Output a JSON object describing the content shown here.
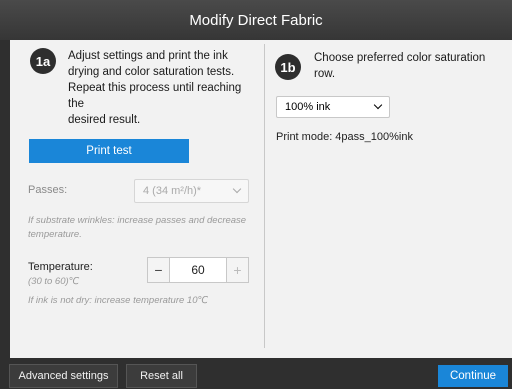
{
  "window": {
    "title": "Modify Direct Fabric"
  },
  "step_a": {
    "badge": "1a",
    "instruction_lines": [
      "Adjust settings and print the ink",
      "drying and color saturation tests.",
      "Repeat this process until reaching the",
      "desired result."
    ],
    "print_button": "Print test",
    "passes": {
      "label": "Passes:",
      "value": "4  (34 m²/h)*",
      "hint_lines": [
        "If substrate wrinkles: increase passes and decrease",
        "temperature."
      ]
    },
    "temperature": {
      "label": "Temperature:",
      "range": "(30 to 60)℃",
      "value": "60",
      "minus": "−",
      "plus": "+",
      "hint": "If ink is not dry: increase temperature 10℃"
    }
  },
  "step_b": {
    "badge": "1b",
    "instruction_lines": [
      "Choose preferred color saturation",
      "row."
    ],
    "ink_select": {
      "value": "100% ink"
    },
    "print_mode": "Print mode: 4pass_100%ink"
  },
  "footer": {
    "advanced": "Advanced settings",
    "reset": "Reset all",
    "continue": "Continue"
  },
  "colors": {
    "accent": "#1a86d8",
    "titlebar": "#3e3e3e",
    "panel": "#f2f2f2"
  }
}
